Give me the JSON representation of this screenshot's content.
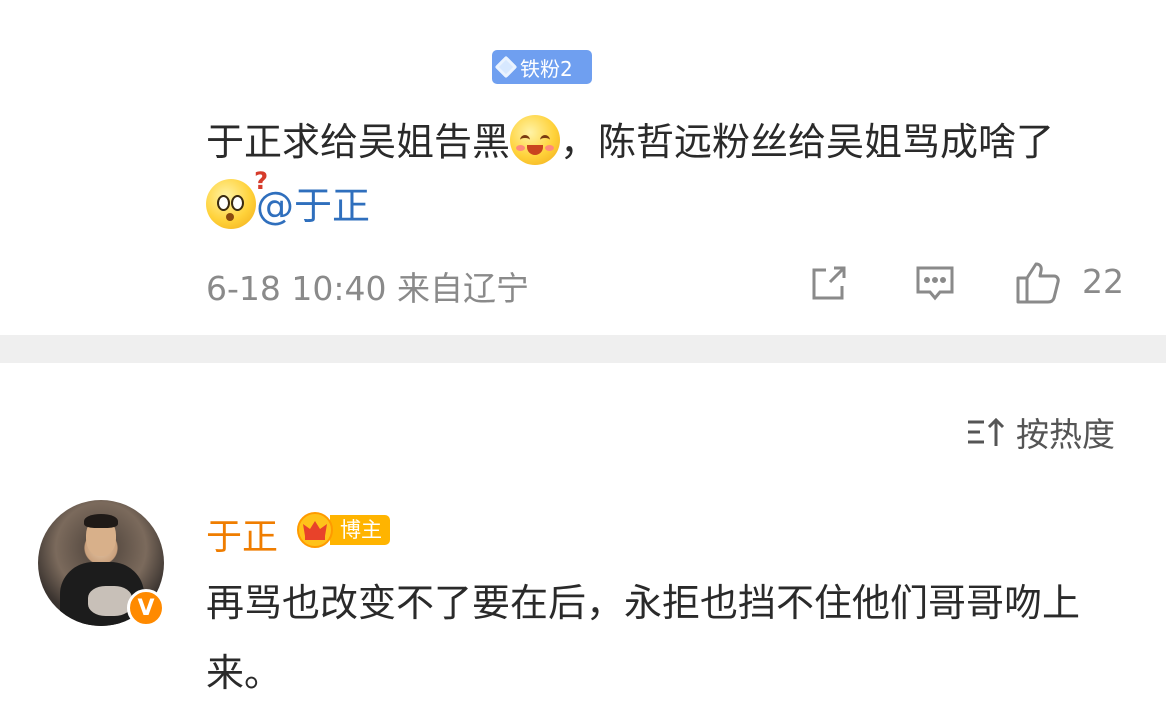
{
  "post": {
    "fan_badge": "铁粉2",
    "text_part1": "于正求给吴姐告黑",
    "emoji1": "blush-smile-emoji",
    "text_part2": "，陈哲远粉丝给吴姐骂成啥了",
    "emoji2": "puzzled-emoji",
    "mention": "@于正",
    "meta": "6-18 10:40 来自辽宁",
    "likes": "22"
  },
  "sort": {
    "label": "按热度",
    "icon": "sort-icon"
  },
  "reply": {
    "username": "于正",
    "badge_label": "博主",
    "text": "再骂也改变不了要在后，永拒也挡不住他们哥哥吻上来。",
    "verified_icon": "verified-v-icon"
  },
  "colors": {
    "username": "#ef7d00",
    "mention": "#2f6fbd",
    "fan_badge": "#6f9ff0",
    "blogger_badge": "#ffb400",
    "meta": "#8a8a8a"
  }
}
